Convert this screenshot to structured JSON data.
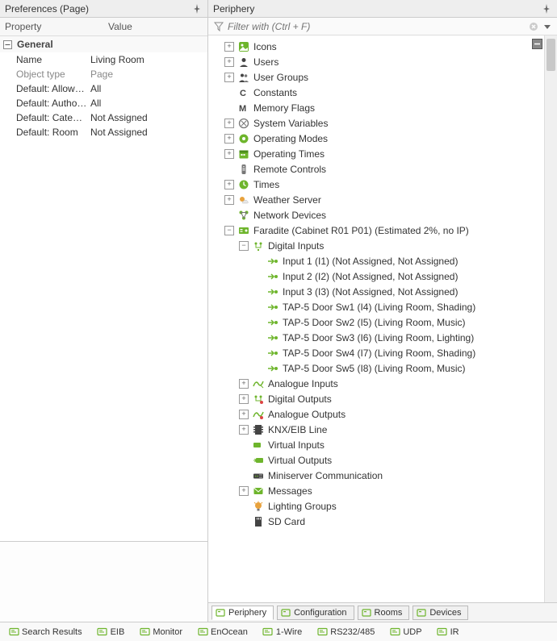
{
  "left": {
    "title": "Preferences (Page)",
    "col1": "Property",
    "col2": "Value",
    "group": "General",
    "rows": [
      {
        "k": "Name",
        "v": "Living Room"
      },
      {
        "k": "Object type",
        "v": "Page",
        "gray": true
      },
      {
        "k": "Default: Allowed ...",
        "v": "All"
      },
      {
        "k": "Default: Authoris...",
        "v": "All"
      },
      {
        "k": "Default: Category",
        "v": "Not Assigned"
      },
      {
        "k": "Default: Room",
        "v": "Not Assigned"
      }
    ]
  },
  "right": {
    "title": "Periphery",
    "filter_placeholder": "Filter with (Ctrl + F)"
  },
  "tree": [
    {
      "d": 1,
      "exp": "+",
      "icon": "icons",
      "label": "Icons"
    },
    {
      "d": 1,
      "exp": "+",
      "icon": "user",
      "label": "Users"
    },
    {
      "d": 1,
      "exp": "+",
      "icon": "users",
      "label": "User Groups"
    },
    {
      "d": 1,
      "exp": "",
      "icon": "const",
      "label": "Constants"
    },
    {
      "d": 1,
      "exp": "",
      "icon": "mem",
      "label": "Memory Flags"
    },
    {
      "d": 1,
      "exp": "+",
      "icon": "sysvar",
      "label": "System Variables"
    },
    {
      "d": 1,
      "exp": "+",
      "icon": "opmode",
      "label": "Operating Modes"
    },
    {
      "d": 1,
      "exp": "+",
      "icon": "optime",
      "label": "Operating Times"
    },
    {
      "d": 1,
      "exp": "",
      "icon": "remote",
      "label": "Remote Controls"
    },
    {
      "d": 1,
      "exp": "+",
      "icon": "clock",
      "label": "Times"
    },
    {
      "d": 1,
      "exp": "+",
      "icon": "weather",
      "label": "Weather Server"
    },
    {
      "d": 1,
      "exp": "",
      "icon": "net",
      "label": "Network Devices"
    },
    {
      "d": 1,
      "exp": "-",
      "icon": "device",
      "label": "Faradite (Cabinet R01 P01) (Estimated 2%, no IP)"
    },
    {
      "d": 2,
      "exp": "-",
      "icon": "digin",
      "label": "Digital Inputs"
    },
    {
      "d": 3,
      "exp": "",
      "icon": "input",
      "label": "Input 1 (I1) (Not Assigned, Not Assigned)"
    },
    {
      "d": 3,
      "exp": "",
      "icon": "input",
      "label": "Input 2 (I2) (Not Assigned, Not Assigned)"
    },
    {
      "d": 3,
      "exp": "",
      "icon": "input",
      "label": "Input 3 (I3) (Not Assigned, Not Assigned)"
    },
    {
      "d": 3,
      "exp": "",
      "icon": "input",
      "label": "TAP-5 Door Sw1 (I4) (Living Room, Shading)"
    },
    {
      "d": 3,
      "exp": "",
      "icon": "input",
      "label": "TAP-5 Door Sw2 (I5) (Living Room, Music)"
    },
    {
      "d": 3,
      "exp": "",
      "icon": "input",
      "label": "TAP-5 Door Sw3 (I6) (Living Room, Lighting)"
    },
    {
      "d": 3,
      "exp": "",
      "icon": "input",
      "label": "TAP-5 Door Sw4 (I7) (Living Room, Shading)"
    },
    {
      "d": 3,
      "exp": "",
      "icon": "input",
      "label": "TAP-5 Door Sw5 (I8) (Living Room, Music)"
    },
    {
      "d": 2,
      "exp": "+",
      "icon": "anain",
      "label": "Analogue Inputs"
    },
    {
      "d": 2,
      "exp": "+",
      "icon": "digout",
      "label": "Digital Outputs"
    },
    {
      "d": 2,
      "exp": "+",
      "icon": "anaout",
      "label": "Analogue Outputs"
    },
    {
      "d": 2,
      "exp": "+",
      "icon": "knx",
      "label": "KNX/EIB Line"
    },
    {
      "d": 2,
      "exp": "",
      "icon": "virtin",
      "label": "Virtual Inputs"
    },
    {
      "d": 2,
      "exp": "",
      "icon": "virtout",
      "label": "Virtual Outputs"
    },
    {
      "d": 2,
      "exp": "",
      "icon": "comm",
      "label": "Miniserver Communication"
    },
    {
      "d": 2,
      "exp": "+",
      "icon": "msg",
      "label": "Messages"
    },
    {
      "d": 2,
      "exp": "",
      "icon": "light",
      "label": "Lighting Groups"
    },
    {
      "d": 2,
      "exp": "",
      "icon": "sd",
      "label": "SD Card"
    }
  ],
  "tabs": [
    {
      "label": "Periphery",
      "active": true
    },
    {
      "label": "Configuration"
    },
    {
      "label": "Rooms"
    },
    {
      "label": "Devices"
    }
  ],
  "status": [
    {
      "label": "Search Results"
    },
    {
      "label": "EIB"
    },
    {
      "label": "Monitor"
    },
    {
      "label": "EnOcean"
    },
    {
      "label": "1-Wire"
    },
    {
      "label": "RS232/485"
    },
    {
      "label": "UDP"
    },
    {
      "label": "IR"
    }
  ]
}
